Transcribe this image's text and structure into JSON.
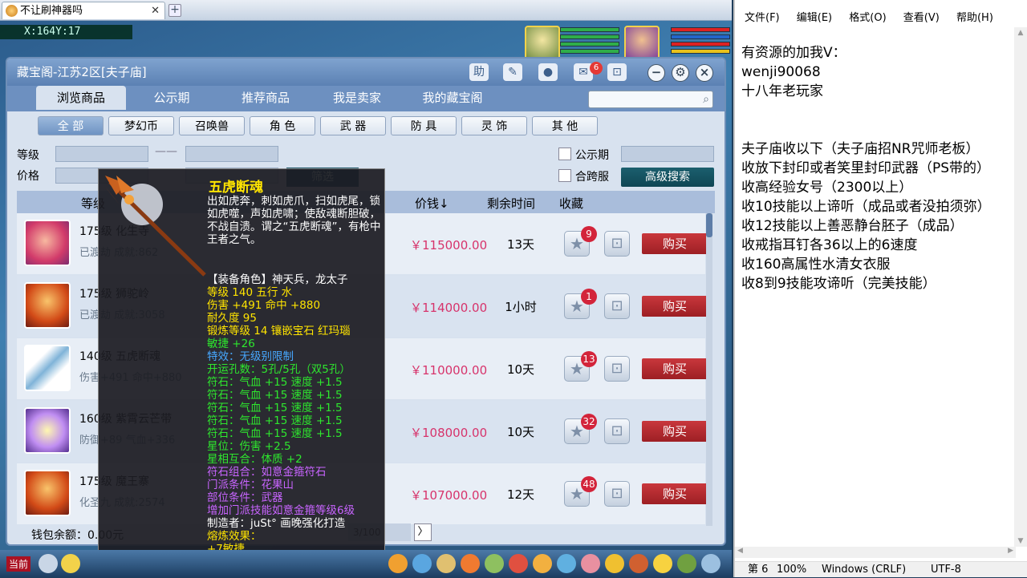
{
  "browser": {
    "tab_title": "不让刷神器吗",
    "close": "✕",
    "add": "+"
  },
  "coords": "X:164Y:17",
  "cbg": {
    "title": "藏宝阁-江苏2区[夫子庙]",
    "help": "助",
    "message_badge": "6",
    "nav_tabs": [
      "浏览商品",
      "公示期",
      "推荐商品",
      "我是卖家",
      "我的藏宝阁"
    ],
    "categories": [
      "全 部",
      "梦幻币",
      "召唤兽",
      "角 色",
      "武 器",
      "防 具",
      "灵 饰",
      "其 他"
    ],
    "filters": {
      "level_label": "等级",
      "price_label": "价格",
      "filter_btn": "筛选",
      "public_label": "公示期",
      "cross_label": "合跨服",
      "advanced_btn": "高级搜索"
    },
    "table_header": {
      "level": "等级",
      "price": "价钱↓",
      "remaining": "剩余时间",
      "fav": "收藏"
    },
    "rows": [
      {
        "name": "175级 化生寺",
        "info": "已渡劫 成就:862",
        "price": "￥115000.00",
        "time": "13天",
        "fav": "9",
        "buy": "购买"
      },
      {
        "name": "175级 狮驼岭",
        "info": "已渡劫 成就:3058",
        "price": "￥114000.00",
        "time": "1小时",
        "fav": "1",
        "buy": "购买"
      },
      {
        "name": "140级 五虎断魂",
        "info": "伤害+491 命中+880",
        "price": "￥110000.00",
        "time": "10天",
        "fav": "13",
        "buy": "购买"
      },
      {
        "name": "160级 紫霄云芒带",
        "info": "防御+89 气血+336",
        "price": "￥108000.00",
        "time": "10天",
        "fav": "32",
        "buy": "购买"
      },
      {
        "name": "175级 魔王寨",
        "info": "化圣九 成就:2574",
        "price": "￥107000.00",
        "time": "12天",
        "fav": "48",
        "buy": "购买"
      }
    ],
    "wallet": "钱包余额：0.00元",
    "page": "3/100",
    "next": "〉"
  },
  "tooltip": {
    "name": "五虎断魂",
    "desc": "出如虎奔，刺如虎爪，扫如虎尾，锁如虎噬，声如虎啸；使敌魂断胆破，不战自溃。谓之“五虎断魂”，有枪中王者之气。",
    "lines": [
      {
        "text": "【装备角色】神天兵，龙太子",
        "color": "#ffffff"
      },
      {
        "text": "等级 140  五行 水",
        "color": "#ffe400"
      },
      {
        "text": "伤害 +491 命中 +880",
        "color": "#ffe400"
      },
      {
        "text": "耐久度 95",
        "color": "#ffe400"
      },
      {
        "text": "锻炼等级 14  镶嵌宝石 红玛瑙",
        "color": "#ffe400"
      },
      {
        "text": "敏捷 +26",
        "color": "#2ee62e"
      },
      {
        "text": "特效：无级别限制",
        "color": "#47a8ff"
      },
      {
        "text": "开运孔数：5孔/5孔（双5孔）",
        "color": "#2ee62e"
      },
      {
        "text": "符石：气血 +15 速度 +1.5",
        "color": "#2ee62e"
      },
      {
        "text": "符石：气血 +15 速度 +1.5",
        "color": "#2ee62e"
      },
      {
        "text": "符石：气血 +15 速度 +1.5",
        "color": "#2ee62e"
      },
      {
        "text": "符石：气血 +15 速度 +1.5",
        "color": "#2ee62e"
      },
      {
        "text": "符石：气血 +15 速度 +1.5",
        "color": "#2ee62e"
      },
      {
        "text": "星位：伤害 +2.5",
        "color": "#2ee62e"
      },
      {
        "text": "星相互合：体质 +2",
        "color": "#2ee62e"
      },
      {
        "text": "符石组合：如意金箍符石",
        "color": "#c864ff"
      },
      {
        "text": "门派条件：花果山",
        "color": "#c864ff"
      },
      {
        "text": "部位条件：武器",
        "color": "#c864ff"
      },
      {
        "text": "增加门派技能如意金箍等级6级",
        "color": "#c864ff"
      },
      {
        "text": "制造者：juSt° 画晚强化打造",
        "color": "#ffffff"
      },
      {
        "text": "熔炼效果：",
        "color": "#ffe400"
      },
      {
        "text": "+7敏捷",
        "color": "#ffe400"
      }
    ]
  },
  "bottombar": {
    "current": "当前"
  },
  "notepad": {
    "menu": [
      "文件(F)",
      "编辑(E)",
      "格式(O)",
      "查看(V)",
      "帮助(H)"
    ],
    "text": "有资源的加我V：\nwenji90068\n十八年老玩家\n\n\n夫子庙收以下（夫子庙招NR咒师老板）\n收放下封印或者笑里封印武器（PS带的）\n收高经验女号（2300以上）\n收10技能以上谛听（成品或者没拍须弥）\n收12技能以上善恶静台胚子（成品）\n收戒指耳钉各36以上的6速度\n收160高属性水清女衣服\n收8到9技能攻谛听（完美技能）",
    "status": {
      "pos": "第 6",
      "zoom": "100%",
      "eol": "Windows (CRLF)",
      "enc": "UTF-8"
    }
  }
}
